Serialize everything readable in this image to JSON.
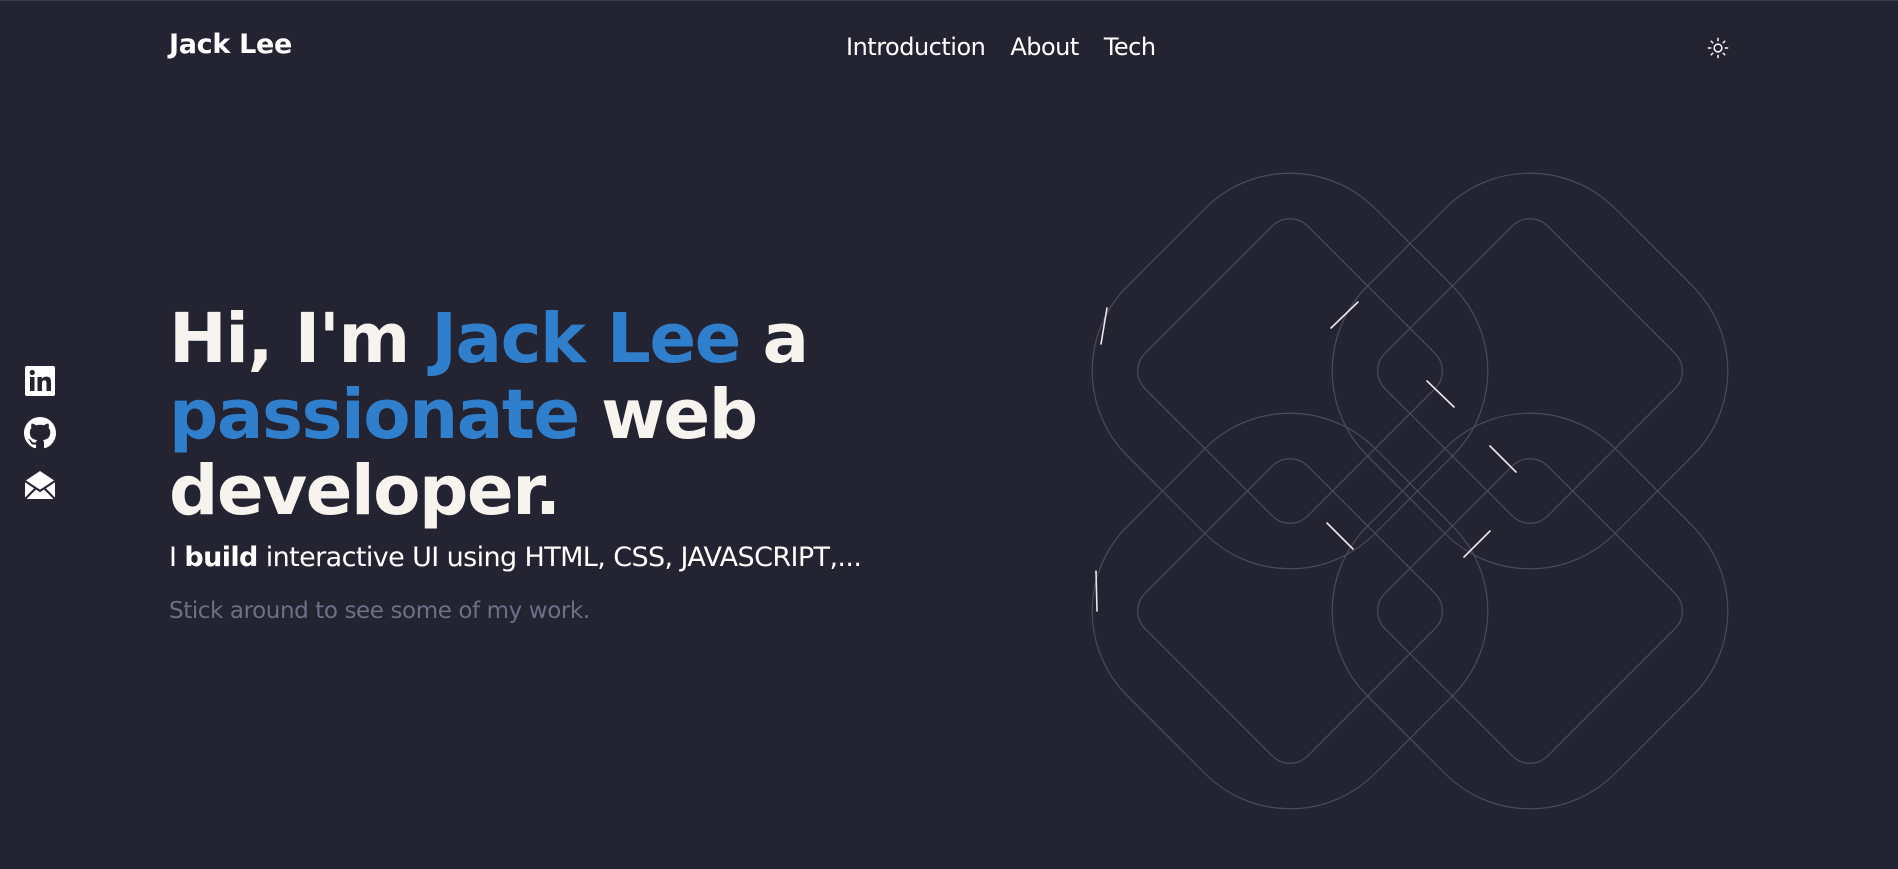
{
  "header": {
    "brand": "Jack Lee",
    "nav": {
      "introduction": "Introduction",
      "about": "About",
      "tech": "Tech"
    },
    "theme_toggle_icon": "sun-icon"
  },
  "socials": {
    "linkedin_icon": "linkedin-icon",
    "github_icon": "github-icon",
    "email_icon": "email-icon"
  },
  "hero": {
    "greeting": "Hi, I'm ",
    "name": "Jack Lee",
    "after_name": " a",
    "passionate": "passionate",
    "after_passionate": " web",
    "developer": "developer.",
    "sub_prefix": "I ",
    "sub_bold": "build",
    "sub_rest": " interactive UI using HTML, CSS, JAVASCRIPT,...",
    "note": "Stick around to see some of my work."
  },
  "colors": {
    "background": "#232332",
    "accent": "#2f7fcd",
    "text": "#f7f4ef",
    "muted": "#6c6f86"
  }
}
